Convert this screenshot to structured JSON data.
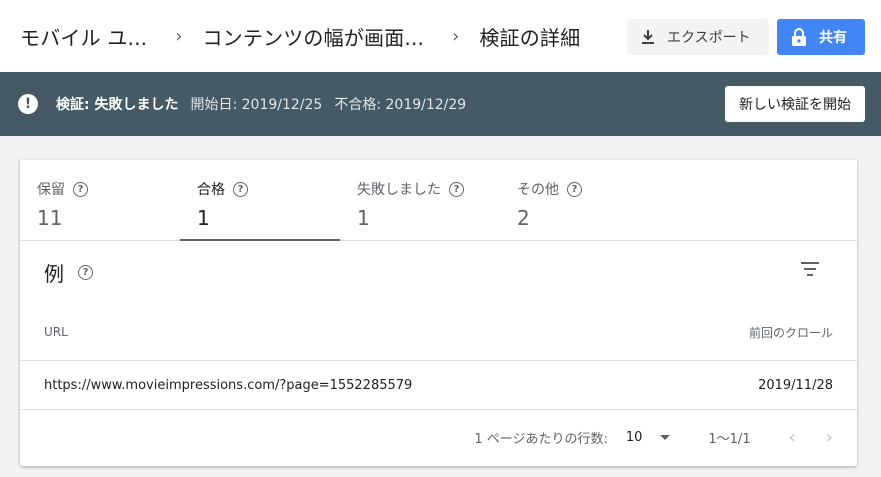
{
  "header": {
    "breadcrumbs": [
      "モバイル ユ...",
      "コンテンツの幅が画面...",
      "検証の詳細"
    ],
    "export_label": "エクスポート",
    "share_label": "共有"
  },
  "status": {
    "label": "検証: 失敗しました",
    "start": "開始日: 2019/12/25",
    "failed": "不合格: 2019/12/29",
    "new_button": "新しい検証を開始"
  },
  "tabs": [
    {
      "label": "保留",
      "count": "11"
    },
    {
      "label": "合格",
      "count": "1"
    },
    {
      "label": "失敗しました",
      "count": "1"
    },
    {
      "label": "その他",
      "count": "2"
    }
  ],
  "examples": {
    "title": "例",
    "columns": {
      "url": "URL",
      "last_crawl": "前回のクロール"
    },
    "rows": [
      {
        "url": "https://www.movieimpressions.com/?page=1552285579",
        "date": "2019/11/28"
      }
    ]
  },
  "pagination": {
    "rows_label": "1 ページあたりの行数:",
    "rows_value": "10",
    "range": "1～1/1"
  },
  "colors": {
    "accent": "#4285f4",
    "status_bar": "#455a64"
  },
  "help_glyph": "?"
}
